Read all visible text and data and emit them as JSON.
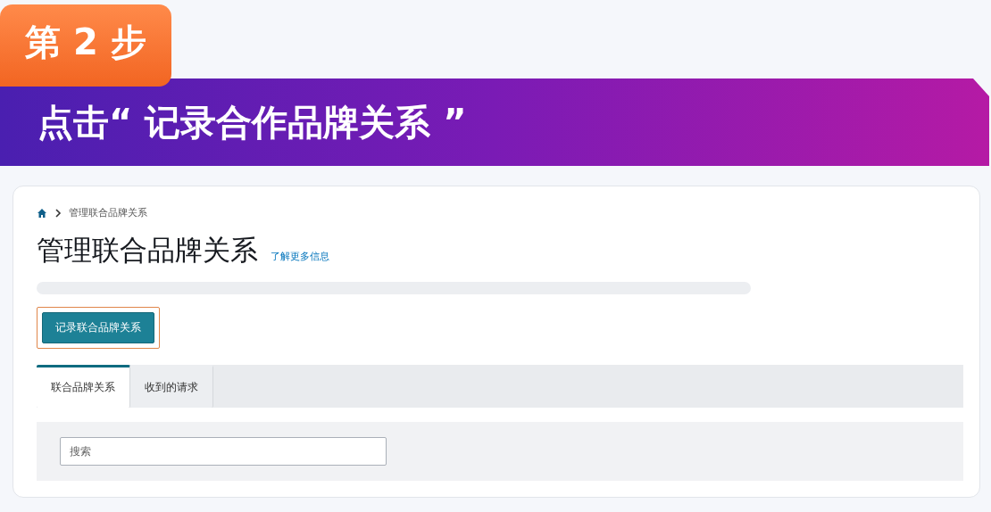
{
  "step_badge": "第 2 步",
  "banner": "点击“ 记录合作品牌关系 ”",
  "breadcrumb": {
    "items": [
      "管理联合品牌关系"
    ]
  },
  "page": {
    "title": "管理联合品牌关系",
    "learn_more": "了解更多信息"
  },
  "action_button": {
    "label": "记录联合品牌关系",
    "highlighted": true
  },
  "tabs": [
    {
      "label": "联合品牌关系",
      "selected": true
    },
    {
      "label": "收到的请求",
      "selected": false
    }
  ],
  "search": {
    "placeholder": "搜索"
  }
}
